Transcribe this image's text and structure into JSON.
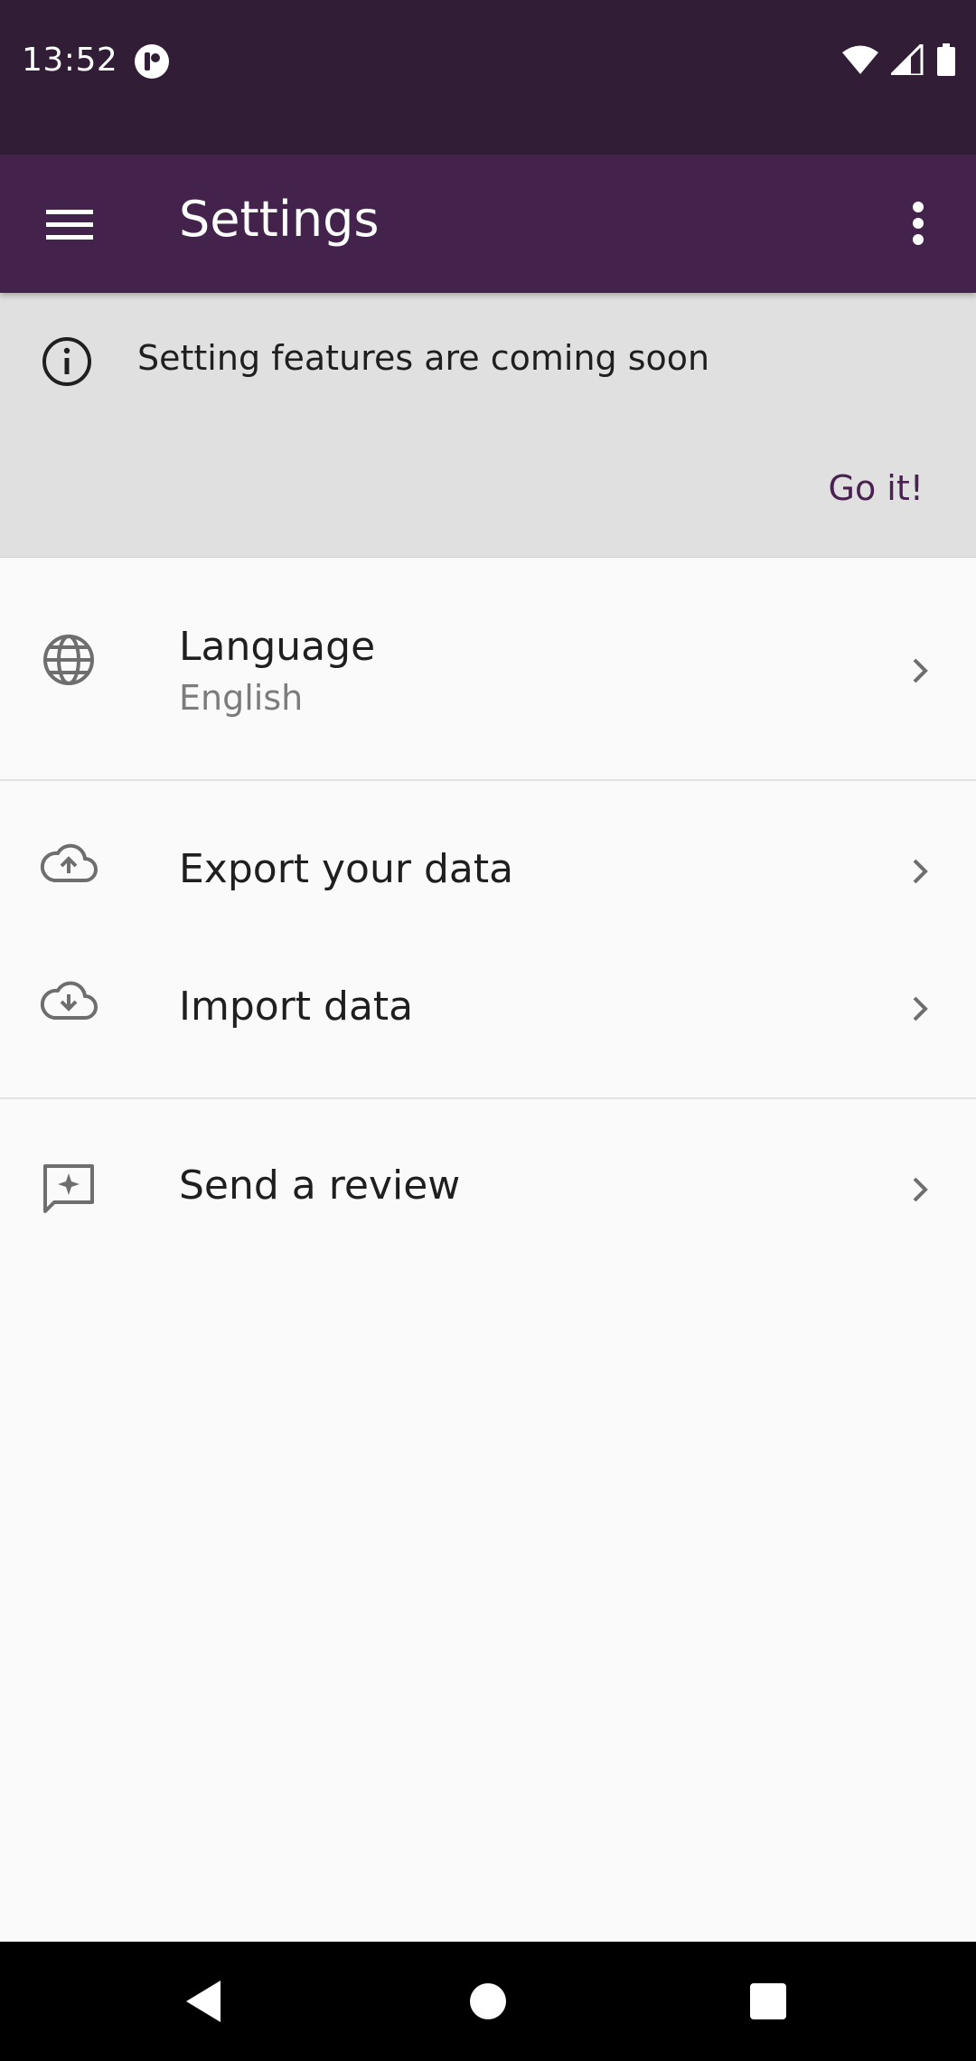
{
  "status_bar": {
    "time": "13:52"
  },
  "app_bar": {
    "title": "Settings"
  },
  "banner": {
    "message": "Setting features are coming soon",
    "action_label": "Go it!"
  },
  "settings": {
    "language": {
      "title": "Language",
      "value": "English"
    },
    "export": {
      "title": "Export your data"
    },
    "import": {
      "title": "Import data"
    },
    "review": {
      "title": "Send a review"
    }
  },
  "colors": {
    "status_bar": "#321d37",
    "app_bar": "#43224b",
    "accent": "#4a2251",
    "banner_bg": "#e0e0e0"
  },
  "icons": [
    "app-status-icon",
    "wifi-icon",
    "signal-icon",
    "battery-icon",
    "menu-icon",
    "more-vert-icon",
    "info-icon",
    "globe-icon",
    "cloud-upload-icon",
    "cloud-download-icon",
    "review-icon",
    "chevron-right-icon",
    "back-icon",
    "home-icon",
    "recents-icon"
  ]
}
